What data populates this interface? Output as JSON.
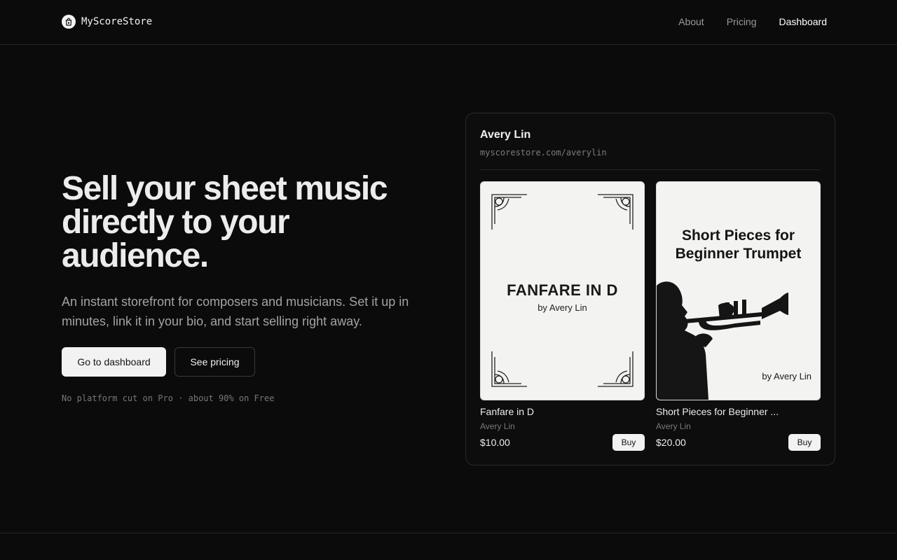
{
  "brand": {
    "name": "MyScoreStore",
    "icon": "shopping-bag-icon"
  },
  "nav": {
    "about": "About",
    "pricing": "Pricing",
    "dashboard": "Dashboard",
    "active": "Dashboard"
  },
  "hero": {
    "title": "Sell your sheet music directly to your audience.",
    "subtitle": "An instant storefront for composers and musicians. Set it up in minutes, link it in your bio, and start selling right away.",
    "primary_cta": "Go to dashboard",
    "secondary_cta": "See pricing",
    "footnote": "No platform cut on Pro · about 90% on Free"
  },
  "store": {
    "name": "Avery Lin",
    "url": "myscorestore.com/averylin",
    "products": [
      {
        "title": "Fanfare in D",
        "author": "Avery Lin",
        "price": "$10.00",
        "buy_label": "Buy",
        "cover_title": "FANFARE IN D",
        "cover_byline": "by Avery Lin"
      },
      {
        "title": "Short Pieces for Beginner ...",
        "author": "Avery Lin",
        "price": "$20.00",
        "buy_label": "Buy",
        "cover_title": "Short Pieces for Beginner Trumpet",
        "cover_byline": "by Avery Lin"
      }
    ]
  },
  "colors": {
    "background": "#0b0b0b",
    "primary_button": "#f2f2f2",
    "muted_text": "#a3a3a3"
  }
}
